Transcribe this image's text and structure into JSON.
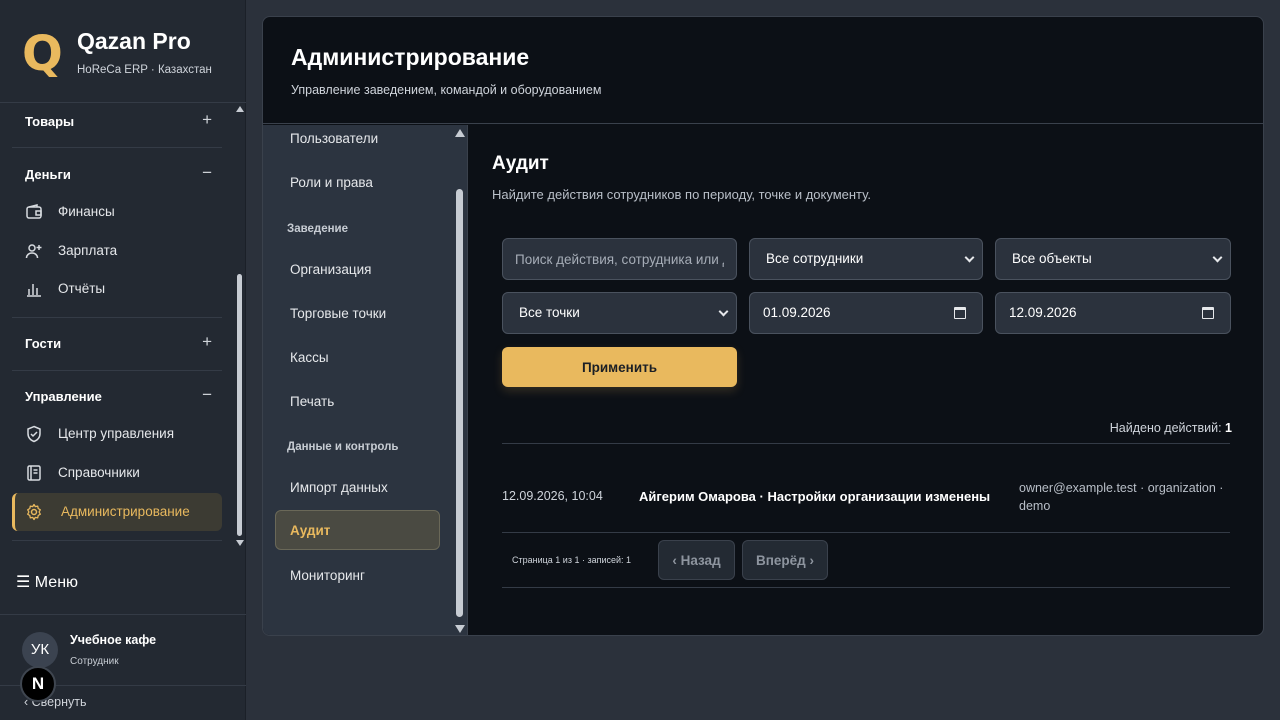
{
  "brand": {
    "logo_letter": "Q",
    "name": "Qazan Pro",
    "subtitle": "HoReCa ERP · Казахстан"
  },
  "sidebar": {
    "groups": [
      {
        "label": "Товары",
        "toggle": "+"
      },
      {
        "label": "Деньги",
        "toggle": "−"
      },
      {
        "label": "Гости",
        "toggle": "+"
      },
      {
        "label": "Управление",
        "toggle": "−"
      }
    ],
    "items": [
      {
        "label": "Финансы",
        "icon": "wallet-icon"
      },
      {
        "label": "Зарплата",
        "icon": "user-plus-icon"
      },
      {
        "label": "Отчёты",
        "icon": "bar-chart-icon"
      },
      {
        "label": "Центр управления",
        "icon": "shield-check-icon"
      },
      {
        "label": "Справочники",
        "icon": "book-icon"
      },
      {
        "label": "Администрирование",
        "icon": "gear-icon"
      }
    ],
    "menu_label": "☰ Меню",
    "user": {
      "initials": "УК",
      "name": "Учебное кафе",
      "role": "Сотрудник"
    },
    "badge": "N",
    "collapse_label": "‹   Свернуть"
  },
  "header": {
    "title": "Администрирование",
    "subtitle": "Управление заведением, командой и оборудованием"
  },
  "subnav": {
    "items_top": [
      "Пользователи",
      "Роли и права"
    ],
    "section_venue": "Заведение",
    "items_venue": [
      "Организация",
      "Торговые точки",
      "Кассы",
      "Печать"
    ],
    "section_data": "Данные и контроль",
    "items_data": [
      "Импорт данных",
      "Аудит",
      "Мониторинг"
    ]
  },
  "audit": {
    "title": "Аудит",
    "subtitle": "Найдите действия сотрудников по периоду, точке и документу.",
    "search_placeholder": "Поиск действия, сотрудника или документа",
    "employee_select": "Все сотрудники",
    "object_select": "Все объекты",
    "point_select": "Все точки",
    "date_from": "01.09.2026",
    "date_to": "12.09.2026",
    "apply_label": "Применить",
    "found_label": "Найдено действий:",
    "found_count": "1",
    "rows": [
      {
        "time": "12.09.2026, 10:04",
        "summary": "Айгерим Омарова · Настройки организации изменены",
        "meta_line1": "owner@example.test · organization ·",
        "meta_line2": "demo"
      }
    ],
    "pager_info": "Страница 1 из 1 · записей: 1",
    "prev_label": "‹ Назад",
    "next_label": "Вперёд ›"
  },
  "colors": {
    "accent": "#e9b95e",
    "panel_bg": "#0c1016",
    "sidebar_bg": "#232932"
  }
}
